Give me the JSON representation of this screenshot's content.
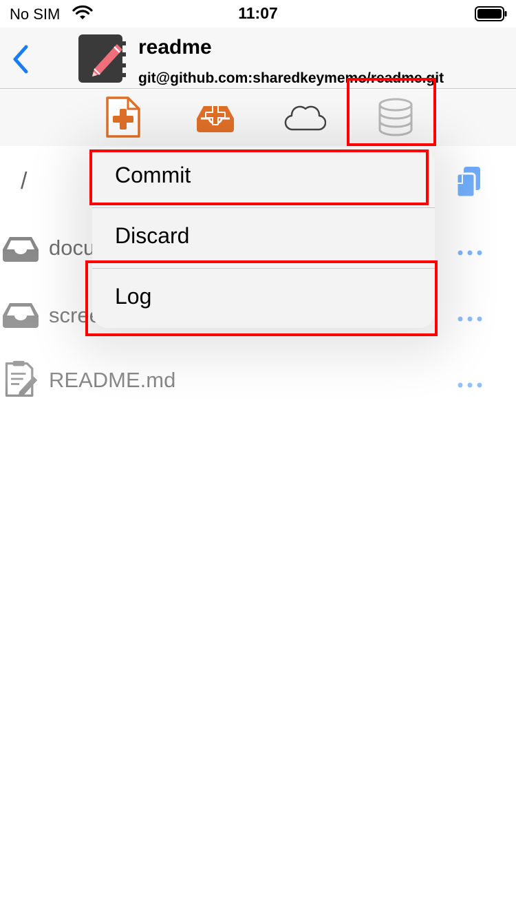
{
  "status_bar": {
    "carrier": "No SIM",
    "time": "11:07"
  },
  "header": {
    "back_icon": "chevron-left-icon",
    "app_icon": "notebook-pencil-icon",
    "title": "readme",
    "subtitle": "git@github.com:sharedkeymemo/readme.git"
  },
  "toolbar": {
    "items": [
      {
        "name": "new-file",
        "icon": "file-plus-icon",
        "color": "#e07028"
      },
      {
        "name": "new-folder",
        "icon": "tray-plus-icon",
        "color": "#e07028"
      },
      {
        "name": "remote",
        "icon": "cloud-icon",
        "color": "#444444"
      },
      {
        "name": "repository",
        "icon": "database-icon",
        "color": "#b8b8b8"
      }
    ]
  },
  "path": {
    "current": "/",
    "copy_icon": "copy-icon"
  },
  "files": [
    {
      "name": "documents",
      "type": "folder",
      "icon": "tray-icon"
    },
    {
      "name": "screenshots",
      "type": "folder",
      "icon": "tray-icon"
    },
    {
      "name": "README.md",
      "type": "file",
      "icon": "document-edit-icon"
    }
  ],
  "menu": {
    "items": [
      {
        "label": "Commit"
      },
      {
        "label": "Discard"
      },
      {
        "label": "Log"
      }
    ]
  },
  "colors": {
    "accent": "#1a7cf5",
    "highlight": "#ff0000",
    "toolbar_orange": "#e07028"
  }
}
